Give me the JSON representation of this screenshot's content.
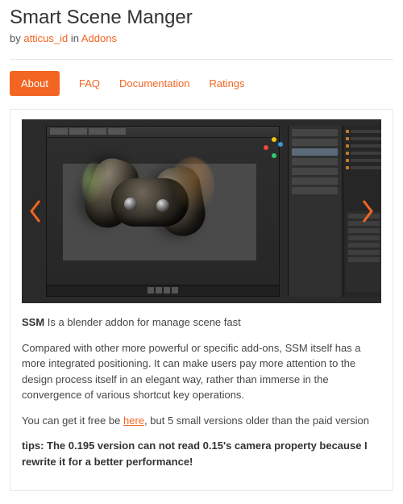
{
  "header": {
    "title": "Smart Scene Manger",
    "by_prefix": "by ",
    "author": "atticus_id",
    "in_word": " in ",
    "category": "Addons"
  },
  "tabs": {
    "about": "About",
    "faq": "FAQ",
    "docs": "Documentation",
    "ratings": "Ratings"
  },
  "description": {
    "lead_bold": "SSM",
    "lead_rest": " Is a blender addon for manage scene fast",
    "para2": "Compared with other more powerful or specific add-ons, SSM itself has a more integrated positioning. It can make users pay more attention to the design process itself in an elegant way, rather than immerse in the convergence of various shortcut key operations.",
    "para3_pre": "You can get it free be  ",
    "para3_link": "here",
    "para3_post": ", but 5 small versions older than the paid version",
    "tip_bold": "tips: The 0.195 version can not read 0.15's camera property because I rewrite it for a better performance!"
  }
}
